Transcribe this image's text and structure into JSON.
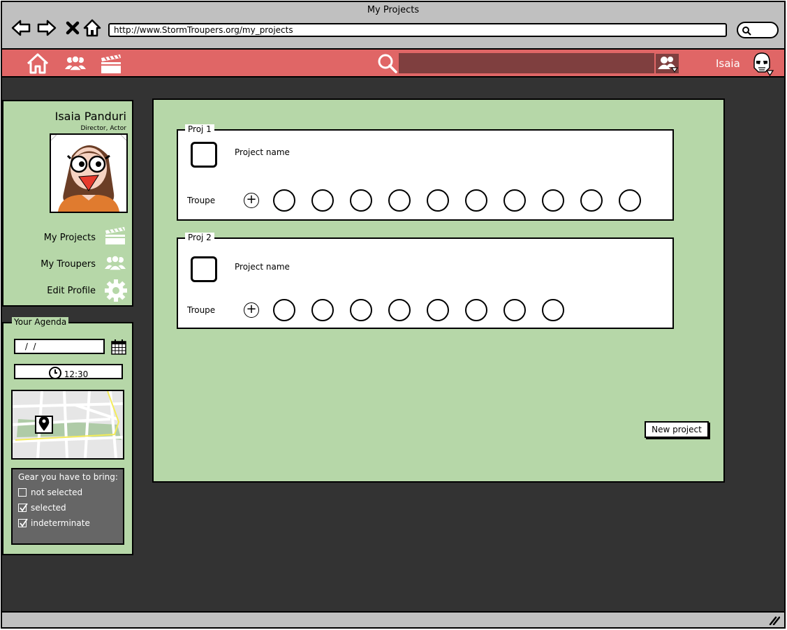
{
  "window": {
    "title": "My Projects"
  },
  "browser": {
    "url": "http://www.StormTroupers.org/my_projects",
    "nav_icons": [
      "back-icon",
      "forward-icon",
      "stop-icon",
      "home-icon"
    ]
  },
  "header": {
    "icons": [
      "home-icon",
      "troupers-icon",
      "clapperboard-icon"
    ],
    "search_value": "",
    "username": "Isaia",
    "accent": "#e06666",
    "search_bg": "#7f3f3f"
  },
  "profile": {
    "name": "Isaia Panduri",
    "role": "Director,  Actor",
    "links": [
      {
        "label": "My Projects",
        "icon": "clapperboard-icon"
      },
      {
        "label": "My Troupers",
        "icon": "troupers-icon"
      },
      {
        "label": "Edit Profile",
        "icon": "gear-icon"
      }
    ]
  },
  "agenda": {
    "legend": "Your Agenda",
    "date": " /  /",
    "time": "12:30",
    "gear": {
      "title": "Gear you have to bring:",
      "items": [
        {
          "label": "not selected",
          "state": "unchecked"
        },
        {
          "label": "selected",
          "state": "checked"
        },
        {
          "label": "indeterminate",
          "state": "checked"
        }
      ]
    }
  },
  "projects": [
    {
      "legend": "Proj 1",
      "name": "Project name",
      "troupe_label": "Troupe",
      "member_count": 10
    },
    {
      "legend": "Proj 2",
      "name": "Project name",
      "troupe_label": "Troupe",
      "member_count": 8
    }
  ],
  "actions": {
    "new_project": "New project"
  },
  "colors": {
    "panel_green": "#b6d7a8",
    "dark_bg": "#333333",
    "chrome_gray": "#c0c0c0",
    "gear_gray": "#666666"
  }
}
